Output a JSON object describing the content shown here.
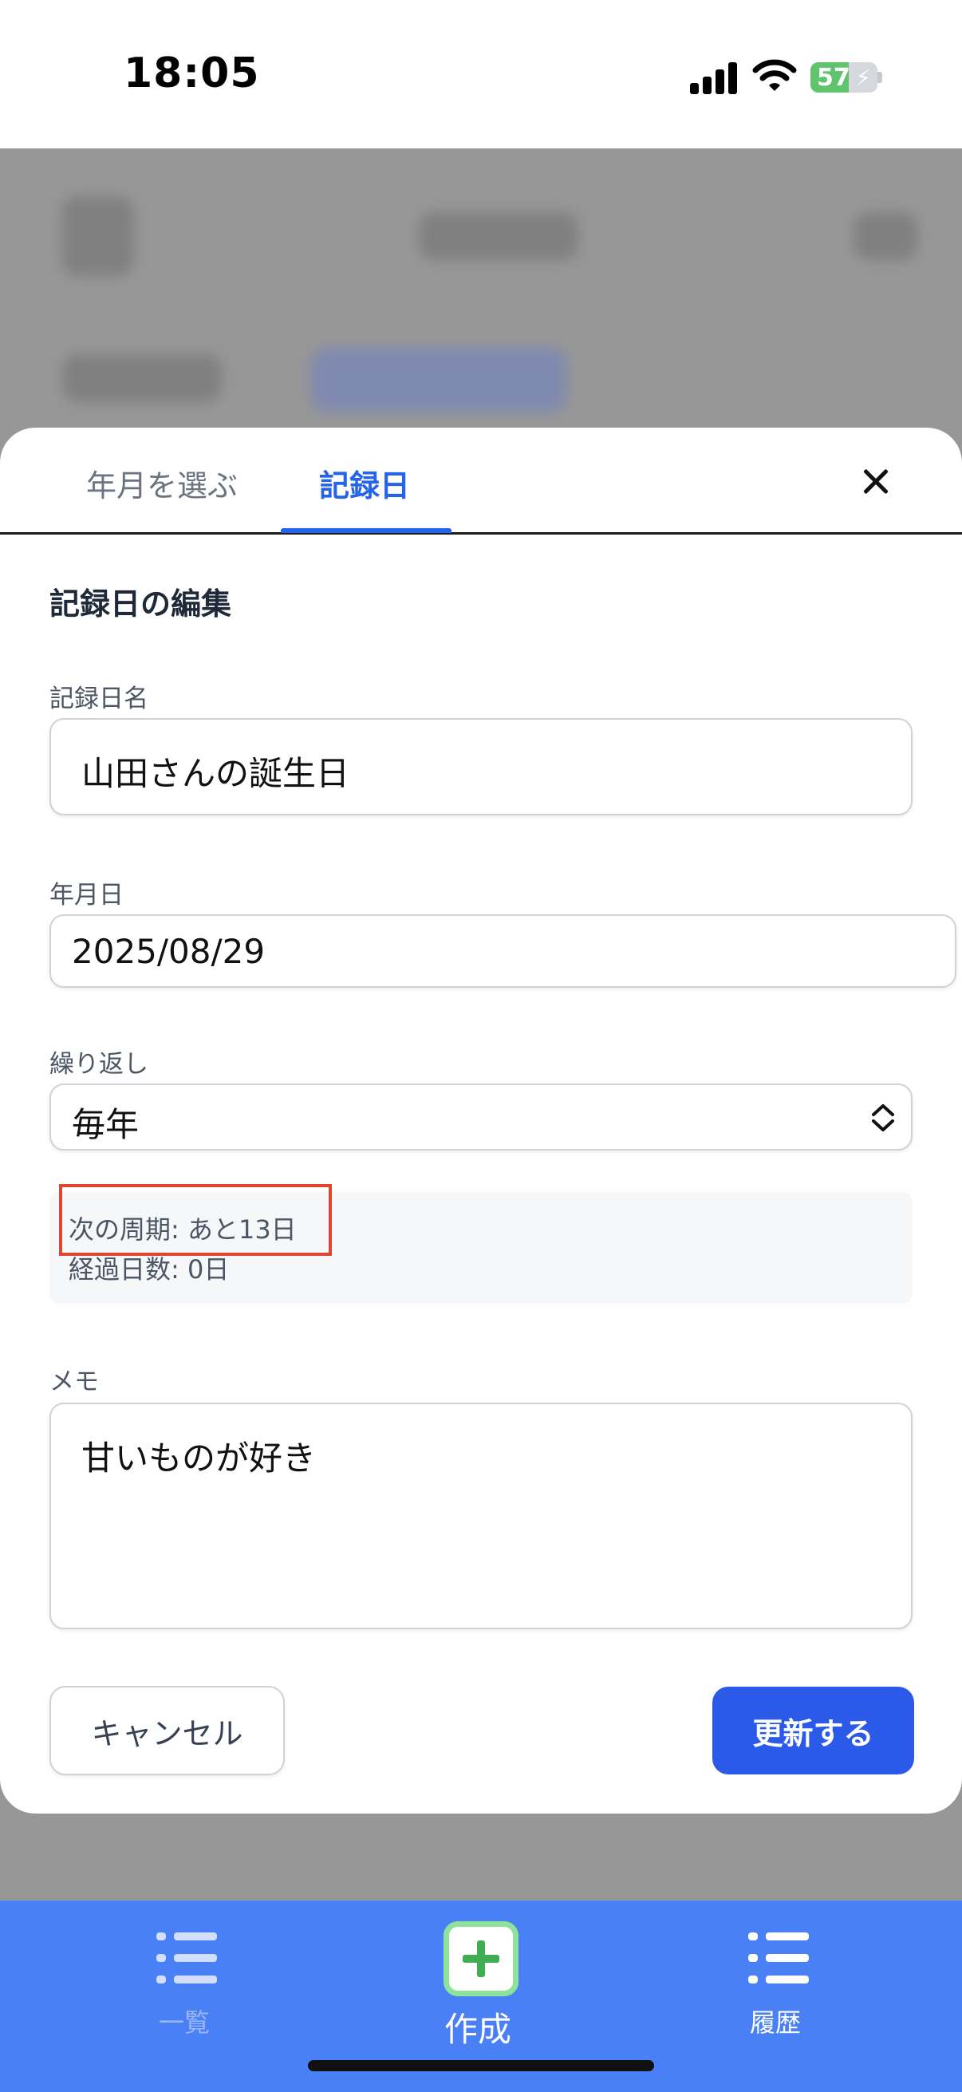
{
  "status_bar": {
    "time": "18:05",
    "battery": "57"
  },
  "modal": {
    "tabs": [
      {
        "label": "年月を選ぶ"
      },
      {
        "label": "記録日"
      }
    ],
    "section_title": "記録日の編集",
    "name_field": {
      "label": "記録日名",
      "value": "山田さんの誕生日"
    },
    "date_field": {
      "label": "年月日",
      "value": "2025/08/29"
    },
    "repeat_field": {
      "label": "繰り返し",
      "value": "毎年"
    },
    "info": {
      "next_cycle": "次の周期: あと13日",
      "elapsed_days": "経過日数: 0日"
    },
    "memo_field": {
      "label": "メモ",
      "value": "甘いものが好き"
    },
    "cancel_button": "キャンセル",
    "update_button": "更新する"
  },
  "tab_bar": {
    "items": [
      {
        "label": "一覧"
      },
      {
        "label": "作成"
      },
      {
        "label": "履歴"
      }
    ]
  },
  "colors": {
    "accent": "#2563eb",
    "primary_button": "#2b59e8",
    "tab_bar": "#4a80f5",
    "highlight": "#e0452e"
  }
}
